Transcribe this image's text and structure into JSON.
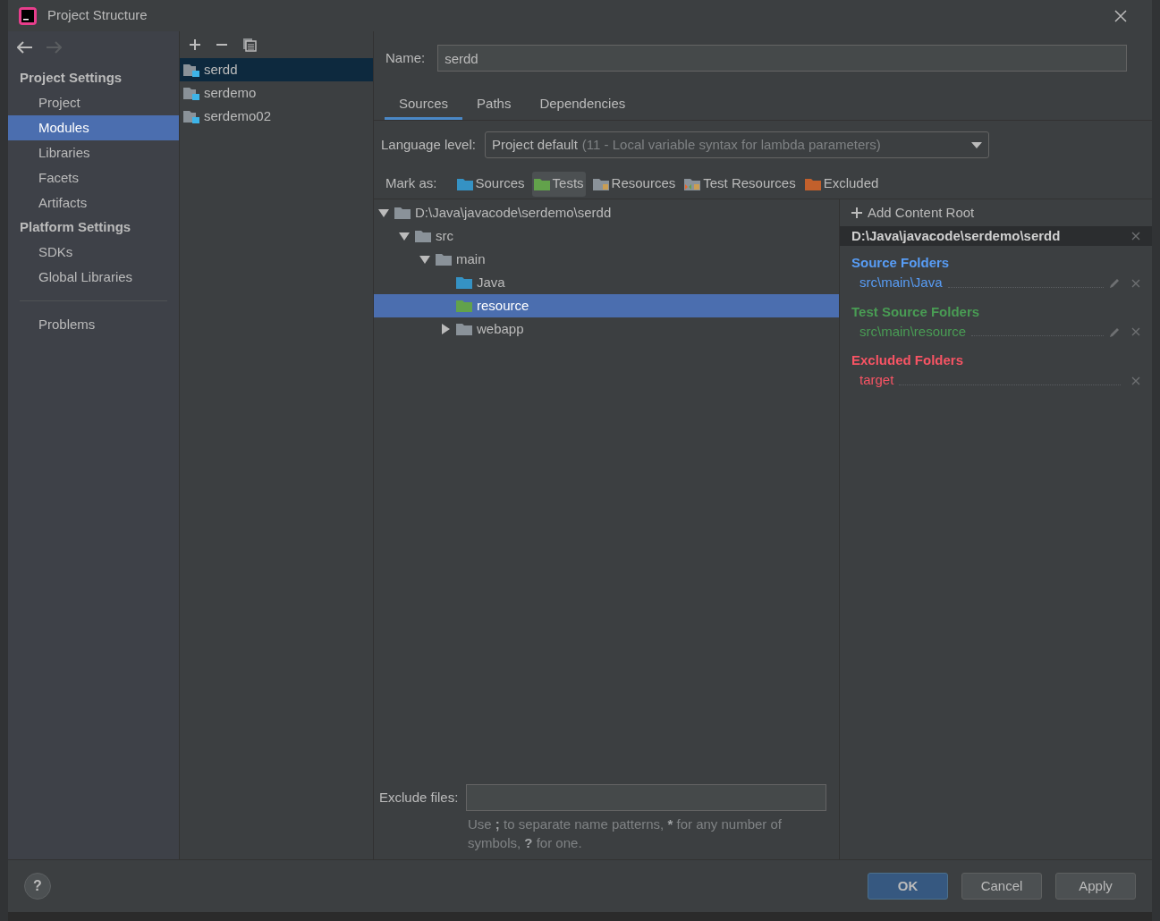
{
  "window": {
    "title": "Project Structure"
  },
  "sidebar": {
    "sections": [
      {
        "heading": "Project Settings",
        "items": [
          {
            "label": "Project",
            "selected": false
          },
          {
            "label": "Modules",
            "selected": true
          },
          {
            "label": "Libraries",
            "selected": false
          },
          {
            "label": "Facets",
            "selected": false
          },
          {
            "label": "Artifacts",
            "selected": false
          }
        ]
      },
      {
        "heading": "Platform Settings",
        "items": [
          {
            "label": "SDKs",
            "selected": false
          },
          {
            "label": "Global Libraries",
            "selected": false
          }
        ]
      }
    ],
    "extra_items": [
      {
        "label": "Problems",
        "selected": false
      }
    ]
  },
  "modules": [
    {
      "name": "serdd",
      "selected": true
    },
    {
      "name": "serdemo",
      "selected": false
    },
    {
      "name": "serdemo02",
      "selected": false
    }
  ],
  "name_field": {
    "label": "Name:",
    "value": "serdd"
  },
  "tabs": [
    {
      "label": "Sources",
      "selected": true
    },
    {
      "label": "Paths",
      "selected": false
    },
    {
      "label": "Dependencies",
      "selected": false
    }
  ],
  "language_level": {
    "label": "Language level:",
    "value": "Project default",
    "detail": "(11 - Local variable syntax for lambda parameters)"
  },
  "mark_as": {
    "label": "Mark as:",
    "buttons": [
      {
        "label": "Sources",
        "kind": "sources",
        "selected": false
      },
      {
        "label": "Tests",
        "kind": "tests",
        "selected": true
      },
      {
        "label": "Resources",
        "kind": "resources",
        "selected": false
      },
      {
        "label": "Test Resources",
        "kind": "test_resources",
        "selected": false
      },
      {
        "label": "Excluded",
        "kind": "excluded",
        "selected": false
      }
    ]
  },
  "tree": [
    {
      "label": "D:\\Java\\javacode\\serdemo\\serdd",
      "kind": "plain",
      "selected": false,
      "expanded": true,
      "children": [
        {
          "label": "src",
          "kind": "plain",
          "selected": false,
          "expanded": true,
          "children": [
            {
              "label": "main",
              "kind": "plain",
              "selected": false,
              "expanded": true,
              "children": [
                {
                  "label": "Java",
                  "kind": "sources",
                  "selected": false
                },
                {
                  "label": "resource",
                  "kind": "tests",
                  "selected": true
                },
                {
                  "label": "webapp",
                  "kind": "plain",
                  "selected": false,
                  "expanded": false
                }
              ]
            }
          ]
        }
      ]
    }
  ],
  "content_roots": {
    "add_button": "Add Content Root",
    "root": "D:\\Java\\javacode\\serdemo\\serdd",
    "groups": [
      {
        "kind": "sources",
        "title": "Source Folders",
        "folders": [
          {
            "path": "src\\main\\Java",
            "editable": true
          }
        ]
      },
      {
        "kind": "tests",
        "title": "Test Source Folders",
        "folders": [
          {
            "path": "src\\main\\resource",
            "editable": true
          }
        ]
      },
      {
        "kind": "excluded",
        "title": "Excluded Folders",
        "folders": [
          {
            "path": "target",
            "editable": false
          }
        ]
      }
    ]
  },
  "exclude_files": {
    "label": "Exclude files:",
    "hint": [
      {
        "text": "Use ",
        "bold": false
      },
      {
        "text": ";",
        "bold": true
      },
      {
        "text": " to separate name patterns, ",
        "bold": false
      },
      {
        "text": "*",
        "bold": true
      },
      {
        "text": " for any number of symbols, ",
        "bold": false
      },
      {
        "text": "?",
        "bold": true
      },
      {
        "text": " for one.",
        "bold": false
      }
    ]
  },
  "help": "?",
  "buttons": [
    {
      "label": "OK",
      "kind": "primary"
    },
    {
      "label": "Cancel",
      "kind": "default"
    },
    {
      "label": "Apply",
      "kind": "default"
    }
  ]
}
